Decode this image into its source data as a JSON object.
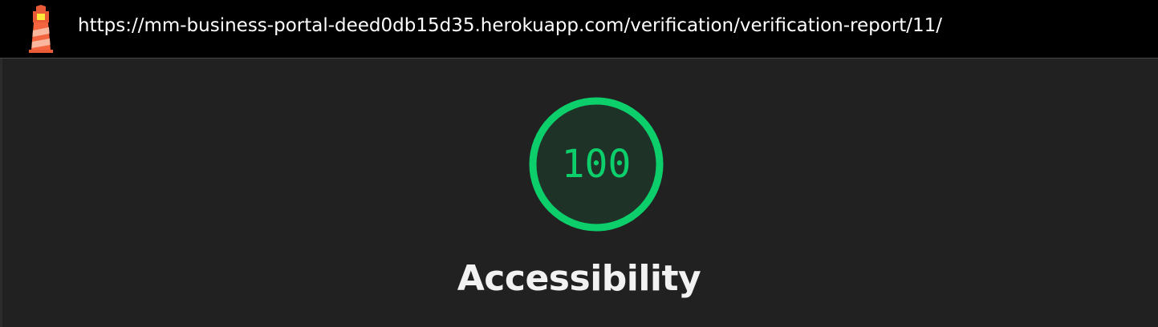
{
  "address_bar": {
    "url": "https://mm-business-portal-deed0db15d35.herokuapp.com/verification/verification-report/11/",
    "icon": "lighthouse-icon"
  },
  "score": {
    "value": "100",
    "fraction": 1.0,
    "category": "Accessibility",
    "color": "#0ccf6b"
  },
  "theme": {
    "background": "#212121",
    "topbar_background": "#000000"
  }
}
